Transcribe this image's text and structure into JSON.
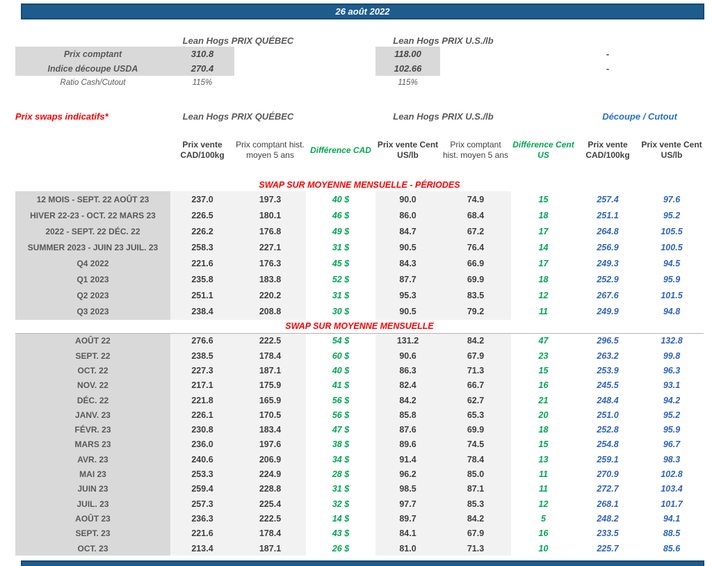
{
  "banner": {
    "date": "26 août 2022"
  },
  "spot": {
    "quebec_header": "Lean Hogs PRIX QUÉBEC",
    "us_header": "Lean Hogs PRIX U.S./lb",
    "rows": [
      {
        "label": "Prix comptant",
        "quebec": "310.8",
        "us": "118.00",
        "dash": "-"
      },
      {
        "label": "Indice découpe USDA",
        "quebec": "270.4",
        "us": "102.66",
        "dash": "-"
      }
    ],
    "ratio": {
      "label": "Ratio Cash/Cutout",
      "quebec": "115%",
      "us": "115%"
    }
  },
  "swaps": {
    "title": "Prix swaps indicatifs*",
    "quebec_header": "Lean Hogs PRIX QUÉBEC",
    "us_header": "Lean Hogs PRIX U.S./lb",
    "cutout_header": "Découpe / Cutout",
    "columns": [
      "Prix vente CAD/100kg",
      "Prix comptant hist. moyen 5 ans",
      "Différence CAD",
      "Prix vente Cent US/lb",
      "Prix comptant hist. moyen 5 ans",
      "Différence Cent US",
      "Prix vente CAD/100kg",
      "Prix vente Cent US/lb"
    ],
    "sections": [
      {
        "title": "SWAP SUR MOYENNE MENSUELLE - PÉRIODES",
        "rows": [
          {
            "label": "12 MOIS - SEPT. 22 AOÛT 23",
            "cells": [
              "237.0",
              "197.3",
              "40 $",
              "90.0",
              "74.9",
              "15",
              "257.4",
              "97.6"
            ]
          },
          {
            "label": "HIVER 22-23 - OCT. 22 MARS 23",
            "cells": [
              "226.5",
              "180.1",
              "46 $",
              "86.0",
              "68.4",
              "18",
              "251.1",
              "95.2"
            ]
          },
          {
            "label": "2022 - SEPT. 22 DÉC. 22",
            "cells": [
              "226.2",
              "176.8",
              "49 $",
              "84.7",
              "67.2",
              "17",
              "264.8",
              "105.5"
            ]
          },
          {
            "label": "SUMMER 2023 - JUIN 23 JUIL. 23",
            "cells": [
              "258.3",
              "227.1",
              "31 $",
              "90.5",
              "76.4",
              "14",
              "256.9",
              "100.5"
            ]
          },
          {
            "label": "Q4 2022",
            "cells": [
              "221.6",
              "176.3",
              "45 $",
              "84.3",
              "66.9",
              "17",
              "249.3",
              "94.5"
            ]
          },
          {
            "label": "Q1 2023",
            "cells": [
              "235.8",
              "183.8",
              "52 $",
              "87.7",
              "69.9",
              "18",
              "252.9",
              "95.9"
            ]
          },
          {
            "label": "Q2 2023",
            "cells": [
              "251.1",
              "220.2",
              "31 $",
              "95.3",
              "83.5",
              "12",
              "267.6",
              "101.5"
            ]
          },
          {
            "label": "Q3 2023",
            "cells": [
              "238.4",
              "208.8",
              "30 $",
              "90.5",
              "79.2",
              "11",
              "249.9",
              "94.8"
            ]
          }
        ]
      },
      {
        "title": "SWAP SUR MOYENNE MENSUELLE",
        "rows": [
          {
            "label": "AOÛT 22",
            "cells": [
              "276.6",
              "222.5",
              "54 $",
              "131.2",
              "84.2",
              "47",
              "296.5",
              "132.8"
            ]
          },
          {
            "label": "SEPT. 22",
            "cells": [
              "238.5",
              "178.4",
              "60 $",
              "90.6",
              "67.9",
              "23",
              "263.2",
              "99.8"
            ]
          },
          {
            "label": "OCT. 22",
            "cells": [
              "227.3",
              "187.1",
              "40 $",
              "86.3",
              "71.3",
              "15",
              "253.9",
              "96.3"
            ]
          },
          {
            "label": "NOV. 22",
            "cells": [
              "217.1",
              "175.9",
              "41 $",
              "82.4",
              "66.7",
              "16",
              "245.5",
              "93.1"
            ]
          },
          {
            "label": "DÉC. 22",
            "cells": [
              "221.8",
              "165.9",
              "56 $",
              "84.2",
              "62.7",
              "21",
              "248.4",
              "94.2"
            ]
          },
          {
            "label": "JANV. 23",
            "cells": [
              "226.1",
              "170.5",
              "56 $",
              "85.8",
              "65.3",
              "20",
              "251.0",
              "95.2"
            ]
          },
          {
            "label": "FÉVR. 23",
            "cells": [
              "230.8",
              "183.4",
              "47 $",
              "87.6",
              "69.9",
              "18",
              "252.8",
              "95.9"
            ]
          },
          {
            "label": "MARS 23",
            "cells": [
              "236.0",
              "197.6",
              "38 $",
              "89.6",
              "74.5",
              "15",
              "254.8",
              "96.7"
            ]
          },
          {
            "label": "AVR. 23",
            "cells": [
              "240.6",
              "206.9",
              "34 $",
              "91.4",
              "78.4",
              "13",
              "259.1",
              "98.3"
            ]
          },
          {
            "label": "MAI 23",
            "cells": [
              "253.3",
              "224.9",
              "28 $",
              "96.2",
              "85.0",
              "11",
              "270.9",
              "102.8"
            ]
          },
          {
            "label": "JUIN 23",
            "cells": [
              "259.4",
              "228.8",
              "31 $",
              "98.5",
              "87.1",
              "11",
              "272.7",
              "103.4"
            ]
          },
          {
            "label": "JUIL. 23",
            "cells": [
              "257.3",
              "225.4",
              "32 $",
              "97.7",
              "85.3",
              "12",
              "268.1",
              "101.7"
            ]
          },
          {
            "label": "AOÛT 23",
            "cells": [
              "236.3",
              "222.5",
              "14 $",
              "89.7",
              "84.2",
              "5",
              "248.2",
              "94.1"
            ]
          },
          {
            "label": "SEPT. 23",
            "cells": [
              "221.6",
              "178.4",
              "43 $",
              "84.1",
              "67.9",
              "16",
              "233.5",
              "88.5"
            ]
          },
          {
            "label": "OCT. 23",
            "cells": [
              "213.4",
              "187.1",
              "26 $",
              "81.0",
              "71.3",
              "10",
              "225.7",
              "85.6"
            ]
          }
        ]
      }
    ]
  },
  "colors": {
    "banner_blue": "#1E5C8E",
    "accent_red": "#FF0000",
    "accent_green": "#00A651",
    "accent_blue": "#2F63BE",
    "label_gray_bg": "#D9D9D9",
    "column_gray_bg": "#F2F2F2"
  }
}
